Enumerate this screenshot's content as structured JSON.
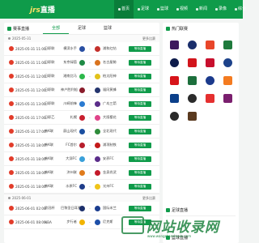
{
  "header": {
    "logo_prefix": "jrs",
    "logo_suffix": "直播",
    "nav": [
      {
        "label": "首页",
        "active": true
      },
      {
        "label": "足球",
        "active": false
      },
      {
        "label": "篮球",
        "active": false
      },
      {
        "label": "视频",
        "active": false
      },
      {
        "label": "新闻",
        "active": false
      },
      {
        "label": "录像",
        "active": false
      },
      {
        "label": "综合",
        "active": false
      }
    ]
  },
  "schedule": {
    "title": "赛事直播",
    "tabs": [
      {
        "label": "全部",
        "active": true
      },
      {
        "label": "足球",
        "active": false
      },
      {
        "label": "篮球",
        "active": false
      }
    ],
    "groups": [
      {
        "date": "2025-05-31",
        "more": "更多比赛",
        "matches": [
          {
            "time": "2025-05-31 11:00",
            "league": "日职联",
            "home": "横滨水手",
            "away": "浦和红钻",
            "button": "等待直播",
            "home_color": "#2a4fa3",
            "away_color": "#c4302b"
          },
          {
            "time": "2025-05-31 11:00",
            "league": "日职联",
            "home": "东京绿茵",
            "away": "名古屋鲸",
            "button": "等待直播",
            "home_color": "#1e8a45",
            "away_color": "#d9731e"
          },
          {
            "time": "2025-05-31 12:00",
            "league": "日职联",
            "home": "湘南比马",
            "away": "柏太阳神",
            "button": "等待直播",
            "home_color": "#2db84b",
            "away_color": "#e2c21b"
          },
          {
            "time": "2025-05-31 12:00",
            "league": "日职联",
            "home": "神户胜利船",
            "away": "福冈黄蜂",
            "button": "等待直播",
            "home_color": "#8a1c2b",
            "away_color": "#25356e"
          },
          {
            "time": "2025-05-31 13:00",
            "league": "日职联",
            "home": "川崎前锋",
            "away": "广岛三箭",
            "button": "等待直播",
            "home_color": "#2a7bd1",
            "away_color": "#5b2d8a"
          },
          {
            "time": "2025-05-31 17:00",
            "league": "日职乙",
            "home": "札幌",
            "away": "大阪樱花",
            "button": "等待直播",
            "home_color": "#c9202f",
            "away_color": "#e0448a"
          },
          {
            "time": "2025-05-31 17:00",
            "league": "韩K联",
            "home": "蔚山现代",
            "away": "全北现代",
            "button": "等待直播",
            "home_color": "#1b4fa0",
            "away_color": "#2e8b3a"
          },
          {
            "time": "2025-05-31 18:00",
            "league": "韩K联",
            "home": "FC首尔",
            "away": "浦项制铁",
            "button": "等待直播",
            "home_color": "#b71e2c",
            "away_color": "#c41a1a"
          },
          {
            "time": "2025-05-31 18:00",
            "league": "韩K联",
            "home": "大邱FC",
            "away": "安养FC",
            "button": "等待直播",
            "home_color": "#3aa0d9",
            "away_color": "#5b2d8a"
          },
          {
            "time": "2025-05-31 18:00",
            "league": "韩K联",
            "home": "济州联",
            "away": "金泉尚武",
            "button": "等待直播",
            "home_color": "#e07b1c",
            "away_color": "#c41a2a"
          },
          {
            "time": "2025-05-31 18:00",
            "league": "韩K联",
            "home": "水原FC",
            "away": "光州FC",
            "button": "等待直播",
            "home_color": "#1f3d8a",
            "away_color": "#f0c419"
          }
        ]
      },
      {
        "date": "2025-06-01",
        "more": "更多比赛",
        "matches": [
          {
            "time": "2025-06-01 02:00",
            "league": "欧冠杯",
            "home": "巴黎圣日耳曼",
            "away": "国际米兰",
            "button": "等待直播",
            "home_color": "#1c2f6b",
            "away_color": "#1b3d8f"
          },
          {
            "time": "2025-06-01 08:00",
            "league": "NBA",
            "home": "步行者",
            "away": "尼克斯",
            "button": "等待直播",
            "home_color": "#f2b400",
            "away_color": "#1d4fa8"
          }
        ]
      }
    ]
  },
  "sidebar": {
    "hot_title": "热门联赛",
    "leagues": [
      {
        "name": "premier-league",
        "color": "#3d185c"
      },
      {
        "name": "champions-league",
        "color": "#1a2e6b"
      },
      {
        "name": "la-liga",
        "color": "#e8462a"
      },
      {
        "name": "serie-a",
        "color": "#1f7a3c"
      },
      {
        "name": "ligue-1",
        "color": "#0d1b4a"
      },
      {
        "name": "bundesliga",
        "color": "#d2151c"
      },
      {
        "name": "eredivisie",
        "color": "#c8102e"
      },
      {
        "name": "nba",
        "color": "#1d428a"
      },
      {
        "name": "j-league",
        "color": "#d7141a"
      },
      {
        "name": "k-league",
        "color": "#1c6f3c"
      },
      {
        "name": "uefa",
        "color": "#1b3a8c"
      },
      {
        "name": "europa",
        "color": "#f47b20"
      },
      {
        "name": "csl",
        "color": "#0b3f8a"
      },
      {
        "name": "afc",
        "color": "#2b2b2b"
      },
      {
        "name": "cba",
        "color": "#e52f2f"
      },
      {
        "name": "a-league",
        "color": "#7a1f6e"
      },
      {
        "name": "saudi",
        "color": "#2a2a2a"
      },
      {
        "name": "cup",
        "color": "#5a3a1f"
      }
    ],
    "section2_title": "足球直播",
    "section3_title": "篮球直播"
  },
  "watermark": {
    "text": "网站收录网",
    "sub": "www.wangzhanshoulu.com"
  }
}
